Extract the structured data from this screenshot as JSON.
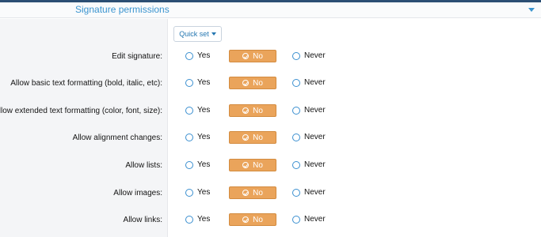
{
  "header": {
    "title": "Signature permissions"
  },
  "quick_set": {
    "label": "Quick set"
  },
  "options": {
    "yes": "Yes",
    "no": "No",
    "never": "Never"
  },
  "selected_option": "No",
  "permissions": [
    {
      "label": "Edit signature:"
    },
    {
      "label": "Allow basic text formatting (bold, italic, etc):"
    },
    {
      "label": "Allow extended text formatting (color, font, size):"
    },
    {
      "label": "Allow alignment changes:"
    },
    {
      "label": "Allow lists:"
    },
    {
      "label": "Allow images:"
    },
    {
      "label": "Allow links:"
    }
  ]
}
